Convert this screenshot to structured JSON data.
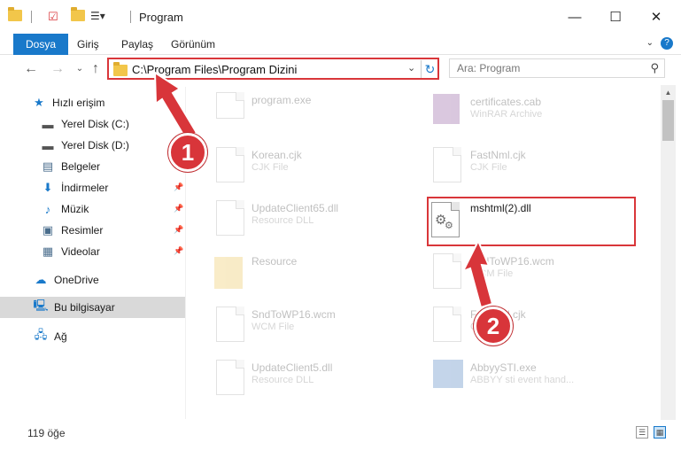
{
  "window": {
    "title": "Program",
    "minimize_icon": "minimize-icon",
    "maximize_icon": "maximize-icon",
    "close_icon": "close-icon"
  },
  "ribbon": {
    "tabs": [
      {
        "label": "Dosya"
      },
      {
        "label": "Giriş"
      },
      {
        "label": "Paylaş"
      },
      {
        "label": "Görünüm"
      }
    ],
    "help_label": "?"
  },
  "address": {
    "path": "C:\\Program Files\\Program Dizini",
    "search_placeholder": "Ara: Program"
  },
  "sidebar": {
    "items": [
      {
        "label": "Hızlı erişim",
        "icon": "star-icon"
      },
      {
        "label": "Yerel Disk (C:)",
        "icon": "drive-icon"
      },
      {
        "label": "Yerel Disk (D:)",
        "icon": "drive-icon"
      },
      {
        "label": "Belgeler",
        "icon": "documents-icon"
      },
      {
        "label": "İndirmeler",
        "icon": "download-icon"
      },
      {
        "label": "Müzik",
        "icon": "music-icon"
      },
      {
        "label": "Resimler",
        "icon": "pictures-icon"
      },
      {
        "label": "Videolar",
        "icon": "videos-icon"
      },
      {
        "label": "OneDrive",
        "icon": "cloud-icon"
      },
      {
        "label": "Bu bilgisayar",
        "icon": "computer-icon"
      },
      {
        "label": "Ağ",
        "icon": "network-icon"
      }
    ]
  },
  "files": {
    "left": [
      {
        "name": "program.exe",
        "type": ""
      },
      {
        "name": "Korean.cjk",
        "type": "CJK File"
      },
      {
        "name": "UpdateClient65.dll",
        "type": "Resource DLL"
      },
      {
        "name": "Resource",
        "type": ""
      },
      {
        "name": "SndToWP16.wcm",
        "type": "WCM File"
      },
      {
        "name": "UpdateClient5.dll",
        "type": "Resource DLL"
      }
    ],
    "right": [
      {
        "name": "certificates.cab",
        "type": "WinRAR Archive"
      },
      {
        "name": "FastNml.cjk",
        "type": "CJK File"
      },
      {
        "name": "mshtml(2).dll",
        "type": ""
      },
      {
        "name": "SndToWP16.wcm",
        "type": "WCM File"
      },
      {
        "name": "FastNml.cjk",
        "type": "CJK File"
      },
      {
        "name": "AbbyySTI.exe",
        "type": "ABBYY sti event hand..."
      }
    ]
  },
  "status": {
    "item_count": "119 öğe"
  },
  "annotations": {
    "step1": "1",
    "step2": "2"
  },
  "colors": {
    "accent": "#1979ca",
    "annotation_red": "#d8353a",
    "folder": "#f2c64a"
  }
}
